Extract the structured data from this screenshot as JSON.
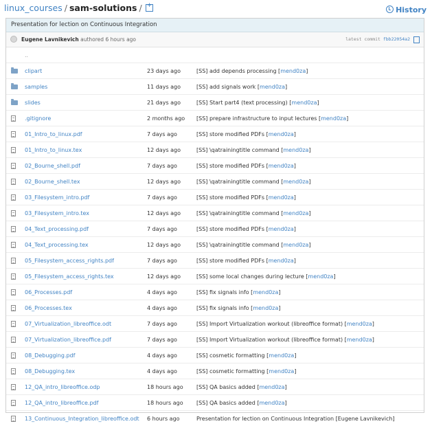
{
  "breadcrumb": {
    "repo": "linux_courses",
    "sep1": "/",
    "folder": "sam-solutions",
    "sep2": "/"
  },
  "history_label": "History",
  "commit": {
    "title": "Presentation for lection on Continuous Integration",
    "author": "Eugene Lavnikevich",
    "authored": "authored",
    "time": "6 hours ago",
    "latest_label": "latest commit",
    "sha": "fbb22054a2"
  },
  "up_dir": "..",
  "rows": [
    {
      "type": "folder",
      "name": "clipart",
      "age": "23 days ago",
      "msg": "[SS] add depends processing [",
      "user": "mend0za",
      "tail": "]"
    },
    {
      "type": "folder",
      "name": "samples",
      "age": "11 days ago",
      "msg": "[SS] add signals work [",
      "user": "mend0za",
      "tail": "]"
    },
    {
      "type": "folder",
      "name": "slides",
      "age": "21 days ago",
      "msg": "[SS] Start part4 (text processing) [",
      "user": "mend0za",
      "tail": "]"
    },
    {
      "type": "file",
      "name": ".gitignore",
      "age": "2 months ago",
      "msg": "[SS] prepare infrastructure to input lectures [",
      "user": "mend0za",
      "tail": "]"
    },
    {
      "type": "file",
      "name": "01_Intro_to_linux.pdf",
      "age": "7 days ago",
      "msg": "[SS] store modified PDFs [",
      "user": "mend0za",
      "tail": "]"
    },
    {
      "type": "file",
      "name": "01_Intro_to_linux.tex",
      "age": "12 days ago",
      "msg": "[SS] \\qatrainingtitle command [",
      "user": "mend0za",
      "tail": "]"
    },
    {
      "type": "file",
      "name": "02_Bourne_shell.pdf",
      "age": "7 days ago",
      "msg": "[SS] store modified PDFs [",
      "user": "mend0za",
      "tail": "]"
    },
    {
      "type": "file",
      "name": "02_Bourne_shell.tex",
      "age": "12 days ago",
      "msg": "[SS] \\qatrainingtitle command [",
      "user": "mend0za",
      "tail": "]"
    },
    {
      "type": "file",
      "name": "03_Filesystem_intro.pdf",
      "age": "7 days ago",
      "msg": "[SS] store modified PDFs [",
      "user": "mend0za",
      "tail": "]"
    },
    {
      "type": "file",
      "name": "03_Filesystem_intro.tex",
      "age": "12 days ago",
      "msg": "[SS] \\qatrainingtitle command [",
      "user": "mend0za",
      "tail": "]"
    },
    {
      "type": "file",
      "name": "04_Text_processing.pdf",
      "age": "7 days ago",
      "msg": "[SS] store modified PDFs [",
      "user": "mend0za",
      "tail": "]"
    },
    {
      "type": "file",
      "name": "04_Text_processing.tex",
      "age": "12 days ago",
      "msg": "[SS] \\qatrainingtitle command [",
      "user": "mend0za",
      "tail": "]"
    },
    {
      "type": "file",
      "name": "05_Filesystem_access_rights.pdf",
      "age": "7 days ago",
      "msg": "[SS] store modified PDFs [",
      "user": "mend0za",
      "tail": "]"
    },
    {
      "type": "file",
      "name": "05_Filesystem_access_rights.tex",
      "age": "12 days ago",
      "msg": "[SS] some local changes during lecture [",
      "user": "mend0za",
      "tail": "]"
    },
    {
      "type": "file",
      "name": "06_Processes.pdf",
      "age": "4 days ago",
      "msg": "[SS] fix signals info [",
      "user": "mend0za",
      "tail": "]"
    },
    {
      "type": "file",
      "name": "06_Processes.tex",
      "age": "4 days ago",
      "msg": "[SS] fix signals info [",
      "user": "mend0za",
      "tail": "]"
    },
    {
      "type": "file",
      "name": "07_Virtualization_libreoffice.odt",
      "age": "7 days ago",
      "msg": "[SS] Import Virtualization workout (libreoffice format) [",
      "user": "mend0za",
      "tail": "]"
    },
    {
      "type": "file",
      "name": "07_Virtualization_libreoffice.pdf",
      "age": "7 days ago",
      "msg": "[SS] Import Virtualization workout (libreoffice format) [",
      "user": "mend0za",
      "tail": "]"
    },
    {
      "type": "file",
      "name": "08_Debugging.pdf",
      "age": "4 days ago",
      "msg": "[SS] cosmetic formatting [",
      "user": "mend0za",
      "tail": "]"
    },
    {
      "type": "file",
      "name": "08_Debugging.tex",
      "age": "4 days ago",
      "msg": "[SS] cosmetic formatting [",
      "user": "mend0za",
      "tail": "]"
    },
    {
      "type": "file",
      "name": "12_QA_intro_libreoffice.odp",
      "age": "18 hours ago",
      "msg": "[SS] QA basics added [",
      "user": "mend0za",
      "tail": "]"
    },
    {
      "type": "file",
      "name": "12_QA_intro_libreoffice.pdf",
      "age": "18 hours ago",
      "msg": "[SS] QA basics added [",
      "user": "mend0za",
      "tail": "]"
    },
    {
      "type": "file",
      "name": "13_Continuous_Integration_libreoffice.odt",
      "age": "6 hours ago",
      "msg": "Presentation for lection on Continuous Integration [Eugene Lavnikevich]",
      "user": "",
      "tail": ""
    }
  ]
}
